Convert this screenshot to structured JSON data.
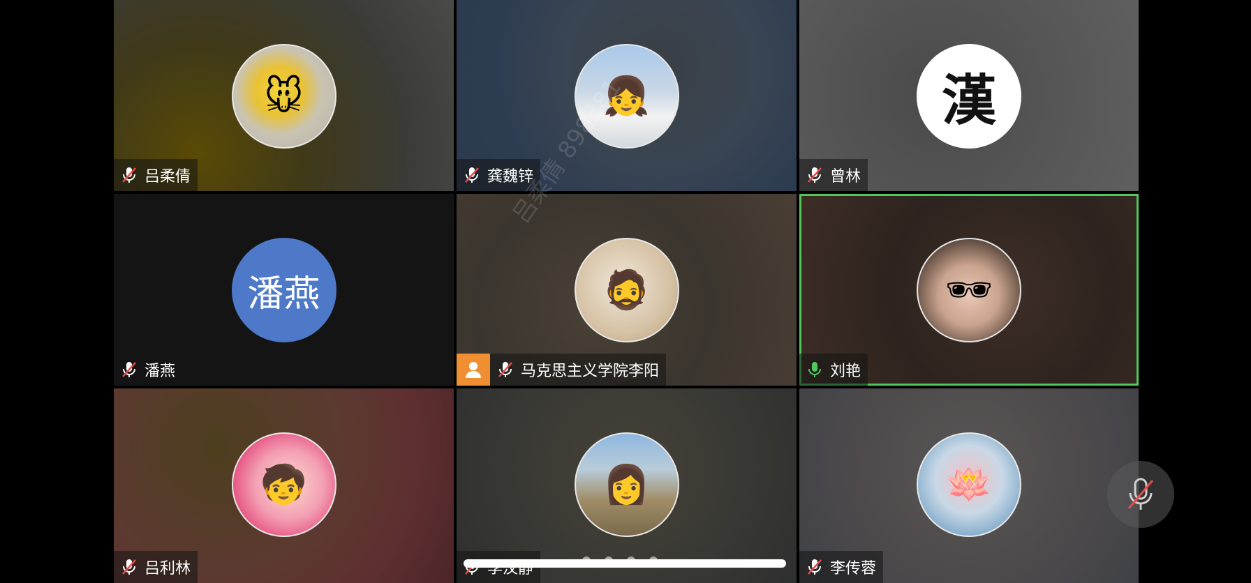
{
  "participants": [
    {
      "name": "吕柔倩",
      "mic": "muted",
      "avatar": "photo-pikachu"
    },
    {
      "name": "龚魏锌",
      "mic": "muted",
      "avatar": "illustration-girl"
    },
    {
      "name": "曾林",
      "mic": "muted",
      "avatar": "text",
      "avatar_text": "漢"
    },
    {
      "name": "潘燕",
      "mic": "muted",
      "avatar": "text",
      "avatar_text": "潘燕"
    },
    {
      "name": "马克思主义学院李阳",
      "mic": "muted",
      "avatar": "sketch-portrait",
      "host": true
    },
    {
      "name": "刘艳",
      "mic": "on",
      "avatar": "photo-sunglasses",
      "active_speaker": true
    },
    {
      "name": "吕利林",
      "mic": "muted",
      "avatar": "cartoon-shinchan"
    },
    {
      "name": "李汶静",
      "mic": "muted",
      "avatar": "photo-field"
    },
    {
      "name": "李传蓉",
      "mic": "muted",
      "avatar": "photo-lotus"
    }
  ],
  "watermark": "吕柔倩 898381",
  "self_mic": "muted",
  "colors": {
    "active_border": "#4fc95e",
    "host_badge": "#f08f32",
    "muted_slash": "#e54b4b",
    "mic_on": "#4fc95e",
    "text_avatar_blue": "#4e79c9"
  },
  "page_indicator": {
    "total": 4
  }
}
